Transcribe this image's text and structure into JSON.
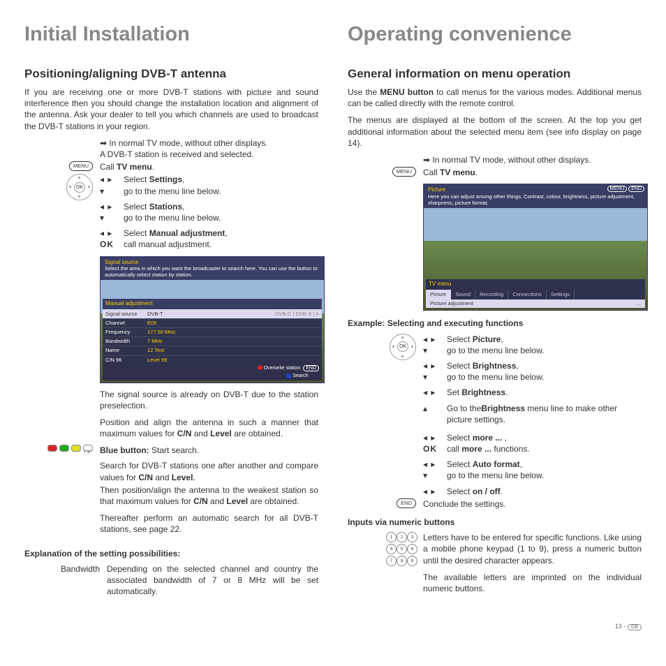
{
  "left": {
    "h1": "Initial Installation",
    "h2": "Positioning/aligning DVB-T antenna",
    "intro": "If you are receiving one or more DVB-T stations with picture and sound interference then you should change the installation location and alignment of the antenna. Ask your dealer to tell you which channels are used to broadcast the DVB-T stations in your region.",
    "line_normal": "In normal TV mode, without other displays.",
    "line_received": "A DVB-T station is received and selected.",
    "menu_label": "MENU",
    "call_tv_pre": "Call ",
    "call_tv_b": "TV menu",
    "call_tv_post": ".",
    "sel_settings_pre": "Select ",
    "sel_settings_b": "Settings",
    "sel_settings_post": ",",
    "goto_below": "go to the menu line below.",
    "sel_stations_pre": "Select ",
    "sel_stations_b": "Stations",
    "sel_stations_post": ",",
    "sel_manual_pre": "Select ",
    "sel_manual_b": "Manual adjustment",
    "sel_manual_post": ",",
    "ok_label": "OK",
    "ok_call_manual": "call manual adjustment.",
    "ss1": {
      "help_title": "Signal source",
      "help_text": "Select the area in which you want the broadcaster to search here. You can use the      button to automatically select station by station.",
      "panel_title": "Manual adjustment",
      "rows": [
        {
          "k": "Signal source",
          "v": "DVB-T",
          "extra": "DVB-C   |   DVB-S   |   A"
        },
        {
          "k": "Channel",
          "v": "E05"
        },
        {
          "k": "Frequency",
          "v": "177.50 MHz"
        },
        {
          "k": "Bandwidth",
          "v": "7 MHz"
        },
        {
          "k": "Name",
          "v": "12 Test"
        },
        {
          "k": "C/N 96",
          "v": "Level 99"
        }
      ],
      "legend1": "Overwrite station",
      "legend2": "Search",
      "tr": "END"
    },
    "after_ss_1": "The signal source is already on DVB-T due to the station preselection.",
    "after_ss_2_pre": "Position and align the antenna in such a manner that maximum values for ",
    "after_ss_2_b1": "C/N",
    "after_ss_2_mid": " and ",
    "after_ss_2_b2": "Level",
    "after_ss_2_post": " are obtained.",
    "blue_b": "Blue button:",
    "blue_post": " Start search.",
    "search_p1_a": "Search for DVB-T stations one after another and compare values for ",
    "search_p1_b1": "C/N",
    "search_p1_mid": " and ",
    "search_p1_b2": "Level",
    "search_p1_post": ".",
    "search_p2_a": "Then position/align the antenna to the weakest station so that maximum values for ",
    "search_p2_b1": "C/N",
    "search_p2_mid": " and ",
    "search_p2_b2": "Level",
    "search_p2_post": " are obtained.",
    "search_p3": "Thereafter perform an automatic search for all DVB-T stations, see page 22.",
    "expl_h": "Explanation of the setting possibilities:",
    "expl_k": "Bandwidth",
    "expl_v": "Depending on the selected channel and country the associated bandwidth of 7 or 8 MHz will be set automatically."
  },
  "right": {
    "h1": "Operating convenience",
    "h2": "General information on menu operation",
    "p1_pre": "Use the ",
    "p1_b": "MENU button",
    "p1_post": " to call menus for the various modes. Additional menus can be called directly with the remote control.",
    "p2": "The menus are displayed at the bottom of the screen. At the top you get additional information about the selected menu item (see info display on page 14).",
    "line_normal": "In normal TV mode, without other displays.",
    "menu_label": "MENU",
    "call_tv_pre": "Call ",
    "call_tv_b": "TV menu",
    "call_tv_post": ".",
    "ss2": {
      "help_title": "Picture",
      "help_text": "Here you can adjust among other things: Contrast, colour, brightness, picture adjustment, sharpness, picture format.",
      "menubar_title": "TV menu",
      "tabs": [
        "Picture",
        "Sound",
        "Recording",
        "Connections",
        "Settings"
      ],
      "sub": "Picture adjustment",
      "sub_ell": "...",
      "tr1": "MENU",
      "tr2": "END"
    },
    "example_h": "Example: Selecting and executing functions",
    "sel_picture_pre": "Select ",
    "sel_picture_b": "Picture",
    "sel_picture_post": ",",
    "goto_below": "go to the menu line below.",
    "sel_bright_pre": "Select ",
    "sel_bright_b": "Brightness",
    "sel_bright_post": ",",
    "set_bright_pre": "Set ",
    "set_bright_b": "Brightness",
    "set_bright_post": ".",
    "up_goto_pre": "Go to the",
    "up_goto_b": "Brightness",
    "up_goto_post": " menu line to make other picture settings.",
    "sel_more_pre": "Select ",
    "sel_more_b": "more ...",
    "sel_more_post": " ,",
    "ok_label": "OK",
    "ok_more_pre": "call ",
    "ok_more_b": "more ...",
    "ok_more_post": " functions.",
    "sel_auto_pre": "Select ",
    "sel_auto_b": "Auto format",
    "sel_auto_post": ",",
    "sel_onoff_pre": "Select ",
    "sel_onoff_b": "on / off",
    "sel_onoff_post": ".",
    "end_label": "END",
    "conclude": "Conclude the settings.",
    "inputs_h": "Inputs via numeric buttons",
    "num_p1": "Letters have to be entered for specific functions. Like using a mobile phone keypad (1 to 9), press a numeric button until the desired character appears.",
    "num_p2": "The available letters are imprinted on the individual numeric buttons."
  },
  "footer": {
    "page": "13 -",
    "gb": "GB"
  }
}
